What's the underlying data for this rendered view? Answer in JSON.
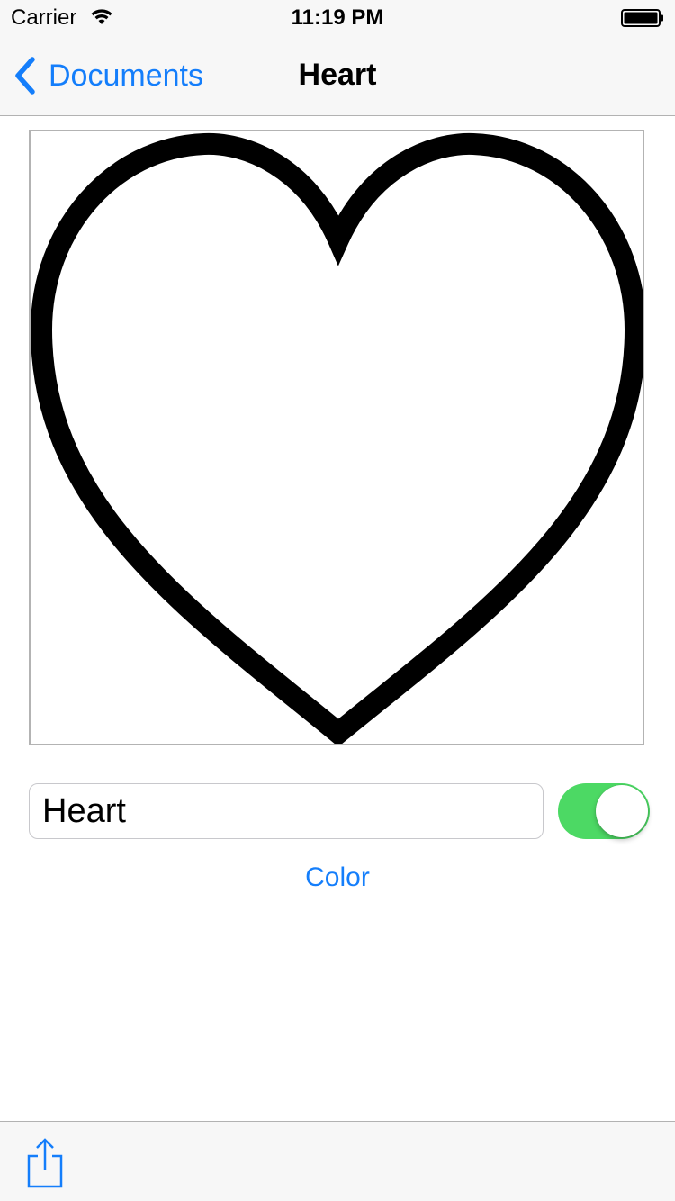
{
  "status_bar": {
    "carrier": "Carrier",
    "time": "11:19 PM",
    "wifi_icon": "wifi-icon",
    "battery_icon": "battery-icon"
  },
  "nav": {
    "back_label": "Documents",
    "back_icon": "chevron-left-icon",
    "title": "Heart"
  },
  "canvas": {
    "shape": "heart-icon",
    "stroke_color": "#000000",
    "fill_color": "#ffffff"
  },
  "editor": {
    "name_value": "Heart",
    "toggle_on": true,
    "toggle_color": "#4cd964",
    "color_button_label": "Color"
  },
  "toolbar": {
    "share_icon": "share-icon"
  },
  "colors": {
    "tint": "#147efb",
    "bar_background": "#f7f7f7"
  }
}
